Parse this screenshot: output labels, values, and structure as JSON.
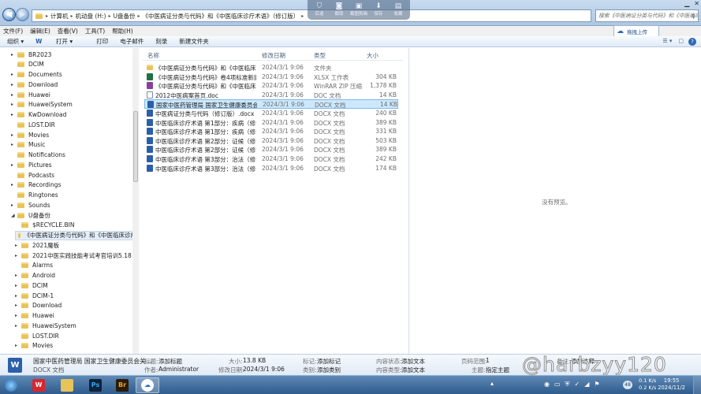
{
  "address": {
    "crumbs": [
      "计算机",
      "机动盘 (H:)",
      "U盘备份",
      "《中医病证分类与代码》和《中医临床诊疗术语》（修订版）"
    ],
    "search_placeholder": "搜索《中医病证分类与代码》和《中医临床..."
  },
  "media_bar": [
    "后退",
    "截取",
    "截图剪辑",
    "保存",
    "收藏"
  ],
  "menu": [
    "文件(F)",
    "编辑(E)",
    "查看(V)",
    "工具(T)",
    "帮助(H)"
  ],
  "upload_button": "拖拽上传",
  "toolbar": {
    "organize": "组织 ▾",
    "open": "打开 ▾",
    "print": "打印",
    "email": "电子邮件",
    "burn": "刻录",
    "new_folder": "新建文件夹"
  },
  "tree": [
    {
      "label": "BR2023",
      "expander": "▸"
    },
    {
      "label": "DCIM",
      "expander": ""
    },
    {
      "label": "Documents",
      "expander": "▸"
    },
    {
      "label": "Download",
      "expander": "▸"
    },
    {
      "label": "Huawei",
      "expander": "▸"
    },
    {
      "label": "HuaweiSystem",
      "expander": "▸"
    },
    {
      "label": "KwDownload",
      "expander": "▸"
    },
    {
      "label": "LOST.DIR",
      "expander": ""
    },
    {
      "label": "Movies",
      "expander": "▸"
    },
    {
      "label": "Music",
      "expander": "▸"
    },
    {
      "label": "Notifications",
      "expander": ""
    },
    {
      "label": "Pictures",
      "expander": "▸"
    },
    {
      "label": "Podcasts",
      "expander": ""
    },
    {
      "label": "Recordings",
      "expander": "▸"
    },
    {
      "label": "Ringtones",
      "expander": ""
    },
    {
      "label": "Sounds",
      "expander": "▸"
    },
    {
      "label": "U盘备份",
      "expander": "◢"
    },
    {
      "label": "$RECYCLE.BIN",
      "expander": ""
    },
    {
      "label": "《中医病证分类与代码》和《中医临床诊疗",
      "expander": ""
    },
    {
      "label": "2021魔板",
      "expander": "▸"
    },
    {
      "label": "2021中医实践技能考试考官培训5.18",
      "expander": "▸"
    },
    {
      "label": "Alarms",
      "expander": ""
    },
    {
      "label": "Android",
      "expander": "▸"
    },
    {
      "label": "DCIM",
      "expander": "▸"
    },
    {
      "label": "DCIM-1",
      "expander": "▸"
    },
    {
      "label": "Download",
      "expander": "▸"
    },
    {
      "label": "Huawei",
      "expander": "▸"
    },
    {
      "label": "HuaweiSystem",
      "expander": "▸"
    },
    {
      "label": "LOST.DIR",
      "expander": ""
    },
    {
      "label": "Movies",
      "expander": "▸"
    }
  ],
  "columns": {
    "name": "名称",
    "date": "修改日期",
    "type": "类型",
    "size": "大小"
  },
  "files": [
    {
      "name": "《中医病证分类与代码》和《中医临床...",
      "date": "2024/3/1 9:06",
      "type": "文件夹",
      "size": "",
      "icon": "folder"
    },
    {
      "name": "《中医病证分类与代码》卷4项标准新旧...",
      "date": "2024/3/1 9:06",
      "type": "XLSX 工作表",
      "size": "304 KB",
      "icon": "xlsx"
    },
    {
      "name": "《中医病证分类与代码》和《中医临床...",
      "date": "2024/3/1 9:06",
      "type": "WinRAR ZIP 压缩...",
      "size": "1,378 KB",
      "icon": "zip"
    },
    {
      "name": "2012中医病案首页.doc",
      "date": "2024/3/1 9:06",
      "type": "DOC 文档",
      "size": "14 KB",
      "icon": "doc"
    },
    {
      "name": "国家中医药管理局 国家卫生健康委员会...",
      "date": "2024/3/1 9:06",
      "type": "DOCX 文档",
      "size": "14 KB",
      "icon": "docx"
    },
    {
      "name": "中医病证分类与代码（修订版）.docx",
      "date": "2024/3/1 9:06",
      "type": "DOCX 文档",
      "size": "240 KB",
      "icon": "docx"
    },
    {
      "name": "中医临床诊疗术语 第1部分：疾病（修订...",
      "date": "2024/3/1 9:06",
      "type": "DOCX 文档",
      "size": "389 KB",
      "icon": "docx"
    },
    {
      "name": "中医临床诊疗术语 第1部分：疾病（修订...",
      "date": "2024/3/1 9:06",
      "type": "DOCX 文档",
      "size": "331 KB",
      "icon": "docx"
    },
    {
      "name": "中医临床诊疗术语 第2部分：证候（修订...",
      "date": "2024/3/1 9:06",
      "type": "DOCX 文档",
      "size": "503 KB",
      "icon": "docx"
    },
    {
      "name": "中医临床诊疗术语 第2部分：证候（修订...",
      "date": "2024/3/1 9:06",
      "type": "DOCX 文档",
      "size": "389 KB",
      "icon": "docx"
    },
    {
      "name": "中医临床诊疗术语 第3部分：治法（修订...",
      "date": "2024/3/1 9:06",
      "type": "DOCX 文档",
      "size": "242 KB",
      "icon": "docx"
    },
    {
      "name": "中医临床诊疗术语 第3部分：治法（修订...",
      "date": "2024/3/1 9:06",
      "type": "DOCX 文档",
      "size": "174 KB",
      "icon": "docx"
    }
  ],
  "preview_text": "没有预览。",
  "details": {
    "filename": "国家中医药管理局 国家卫生健康委员会关...",
    "filetype": "DOCX 文档",
    "title_label": "标题:",
    "title_value": "添加标题",
    "author_label": "作者:",
    "author_value": "Administrator",
    "size_label": "大小:",
    "size_value": "13.8 KB",
    "modified_label": "修改日期:",
    "modified_value": "2024/3/1 9:06",
    "tags_label": "标记:",
    "tags_value": "添加标记",
    "category_label": "类别:",
    "category_value": "添加类别",
    "content_status_label": "内容状态:",
    "content_status_value": "添加文本",
    "content_type_label": "内容类型:",
    "content_type_value": "添加文本",
    "pages_label": "页码范围:",
    "pages_value": "1",
    "subject_label": "主题:",
    "subject_value": "指定主题",
    "comments_label": "备注:",
    "comments_value": "添加注释"
  },
  "watermark": "@harbzyy120",
  "taskbar": {
    "badge": "48",
    "net_up": "0.1 K/s",
    "net_down": "0.2 K/s",
    "time": "19:55",
    "date": "2024/11/2"
  }
}
